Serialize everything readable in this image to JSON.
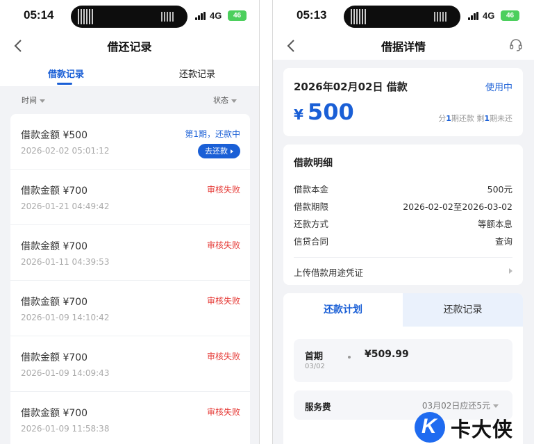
{
  "left": {
    "status_bar": {
      "time": "05:14",
      "network": "4G",
      "battery": "46"
    },
    "title": "借还记录",
    "tabs": [
      {
        "label": "借款记录"
      },
      {
        "label": "还款记录"
      }
    ],
    "filters": {
      "time": "时间",
      "status": "状态"
    },
    "loans": [
      {
        "amount": "借款金额 ¥500",
        "date": "2026-02-02 05:01:12",
        "status": "第1期，还款中",
        "status_color": "blue",
        "action": "去还款"
      },
      {
        "amount": "借款金额 ¥700",
        "date": "2026-01-21 04:49:42",
        "status": "审核失败",
        "status_color": "red"
      },
      {
        "amount": "借款金额 ¥700",
        "date": "2026-01-11 04:39:53",
        "status": "审核失败",
        "status_color": "red"
      },
      {
        "amount": "借款金额 ¥700",
        "date": "2026-01-09 14:10:42",
        "status": "审核失败",
        "status_color": "red"
      },
      {
        "amount": "借款金额 ¥700",
        "date": "2026-01-09 14:09:43",
        "status": "审核失败",
        "status_color": "red"
      },
      {
        "amount": "借款金额 ¥700",
        "date": "2026-01-09 11:58:38",
        "status": "审核失败",
        "status_color": "red"
      }
    ]
  },
  "right": {
    "status_bar": {
      "time": "05:13",
      "network": "4G",
      "battery": "46"
    },
    "title": "借据详情",
    "summary": {
      "date_label": "2026年02月02日 借款",
      "state": "使用中",
      "currency": "¥",
      "amount": "500",
      "plan_prefix": "分",
      "plan_total": "1",
      "plan_mid": "期还款 剩",
      "plan_left": "1",
      "plan_suffix": "期未还"
    },
    "detail": {
      "title": "借款明细",
      "rows": [
        {
          "label": "借款本金",
          "value": "500元"
        },
        {
          "label": "借款期限",
          "value": "2026-02-02至2026-03-02"
        },
        {
          "label": "还款方式",
          "value": "等额本息"
        },
        {
          "label": "信贷合同",
          "value": "查询"
        }
      ],
      "upload": "上传借款用途凭证"
    },
    "plan_tabs": [
      {
        "label": "还款计划"
      },
      {
        "label": "还款记录"
      }
    ],
    "installment": {
      "period": "首期",
      "date": "03/02",
      "amount": "¥509.99"
    },
    "fee": {
      "label": "服务费",
      "value": "03月02日应还5元"
    }
  },
  "watermark": {
    "logo_letter": "K",
    "text": "卡大侠"
  },
  "colors": {
    "accent": "#1a5fd6",
    "error": "#e53935",
    "battery": "#4ccf5d"
  }
}
